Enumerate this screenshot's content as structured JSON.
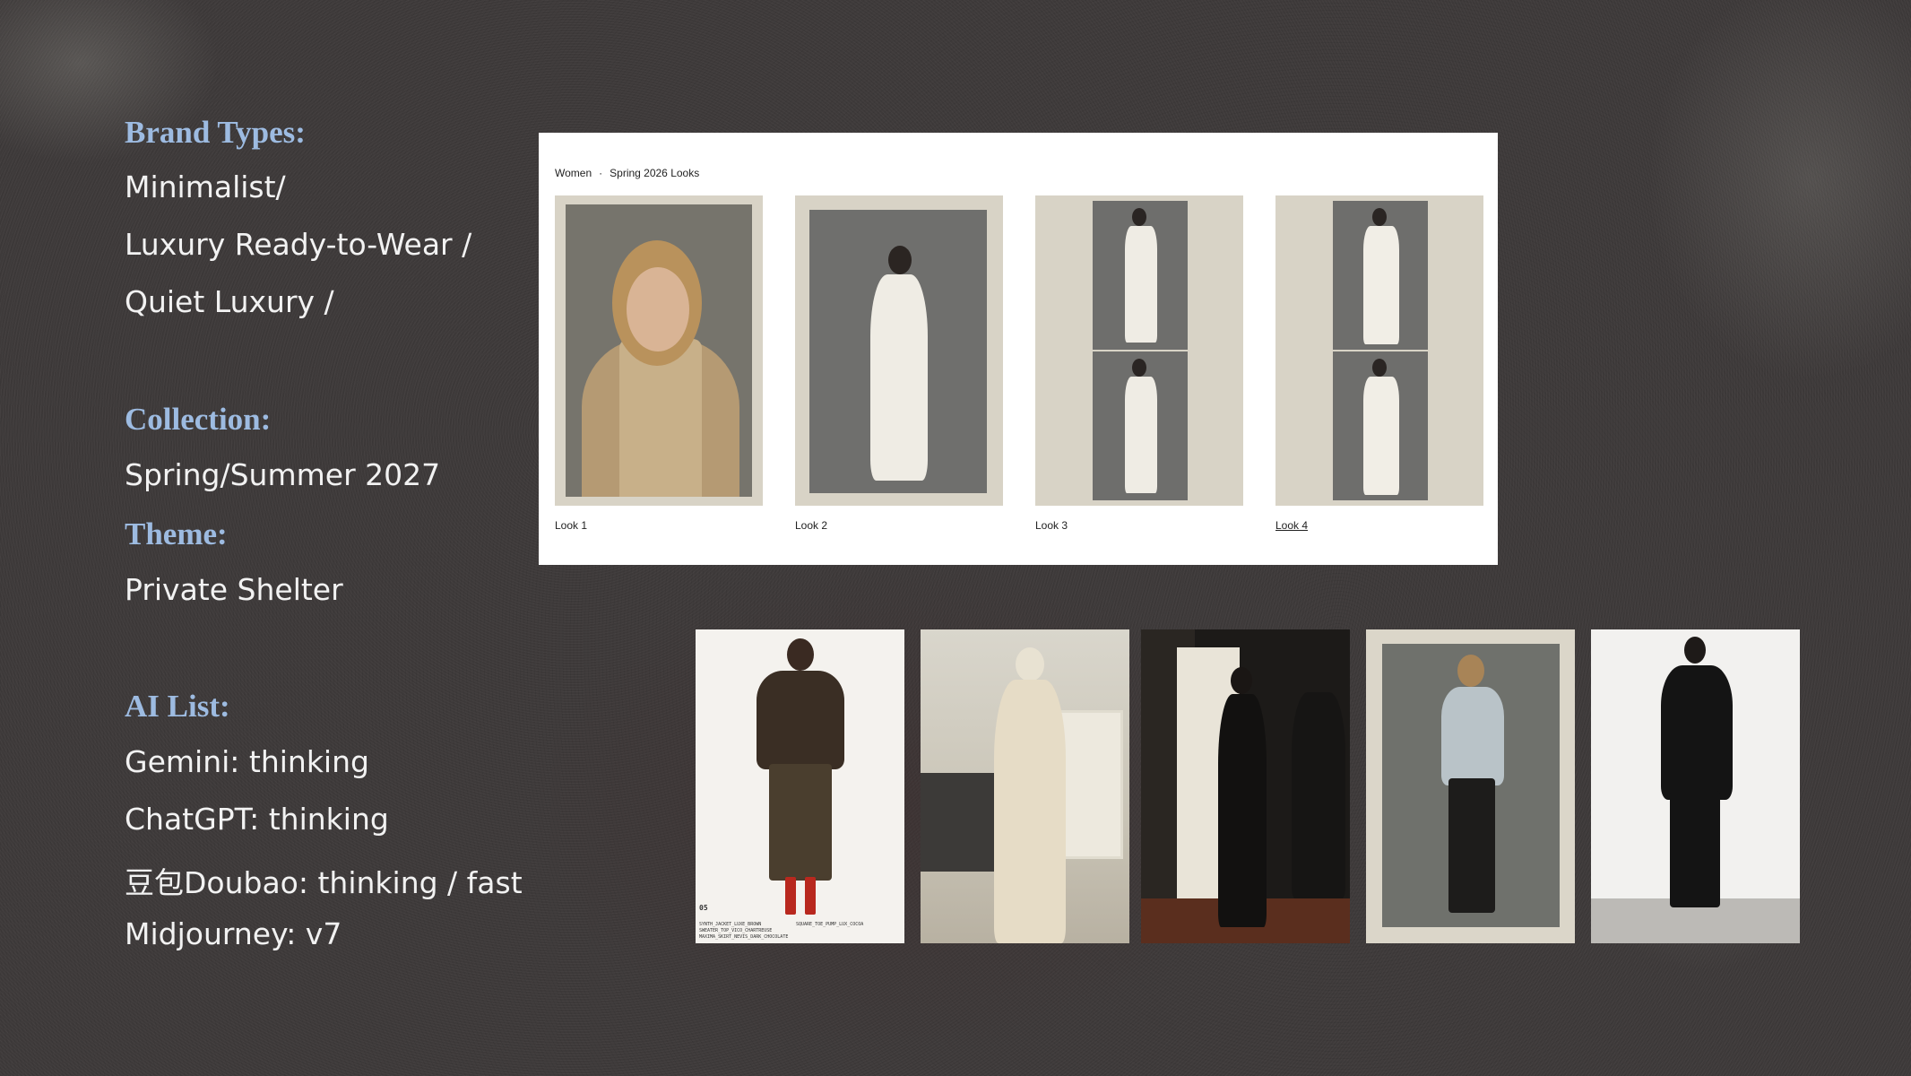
{
  "sections": {
    "brand": {
      "heading": "Brand Types:",
      "lines": [
        "Minimalist/",
        "Luxury Ready-to-Wear /",
        "Quiet Luxury /"
      ]
    },
    "collection": {
      "heading": "Collection:",
      "lines": [
        "Spring/Summer 2027"
      ]
    },
    "theme": {
      "heading": "Theme:",
      "lines": [
        "Private Shelter"
      ]
    },
    "ai": {
      "heading": "AI List:",
      "lines": [
        "Gemini: thinking",
        "ChatGPT: thinking",
        "豆包Doubao: thinking / fast",
        "Midjourney: v7"
      ]
    }
  },
  "lookbook": {
    "breadcrumb": [
      "Women",
      "Spring 2026 Looks"
    ],
    "separator": "·",
    "looks": [
      {
        "label": "Look 1"
      },
      {
        "label": "Look 2"
      },
      {
        "label": "Look 3"
      },
      {
        "label": "Look 4",
        "selected": true
      }
    ]
  },
  "gallery": {
    "tile1_number": "05",
    "tile1_caption_left": [
      "SYNTH_JACKET_LUXE_BROWN",
      "SWEATER_TOP_VICO_CHARTREUSE",
      "MAXIMA_SKIRT_NEVIS_DARK_CHOCOLATE"
    ],
    "tile1_caption_right": "SQUARE_TOE_PUMP_LUX_COCOA"
  },
  "colors": {
    "heading": "#9dbbe1",
    "text": "#f2f2f2",
    "background": "#3e3a3a",
    "panel": "#ffffff",
    "frame": "#d8d3c6"
  }
}
